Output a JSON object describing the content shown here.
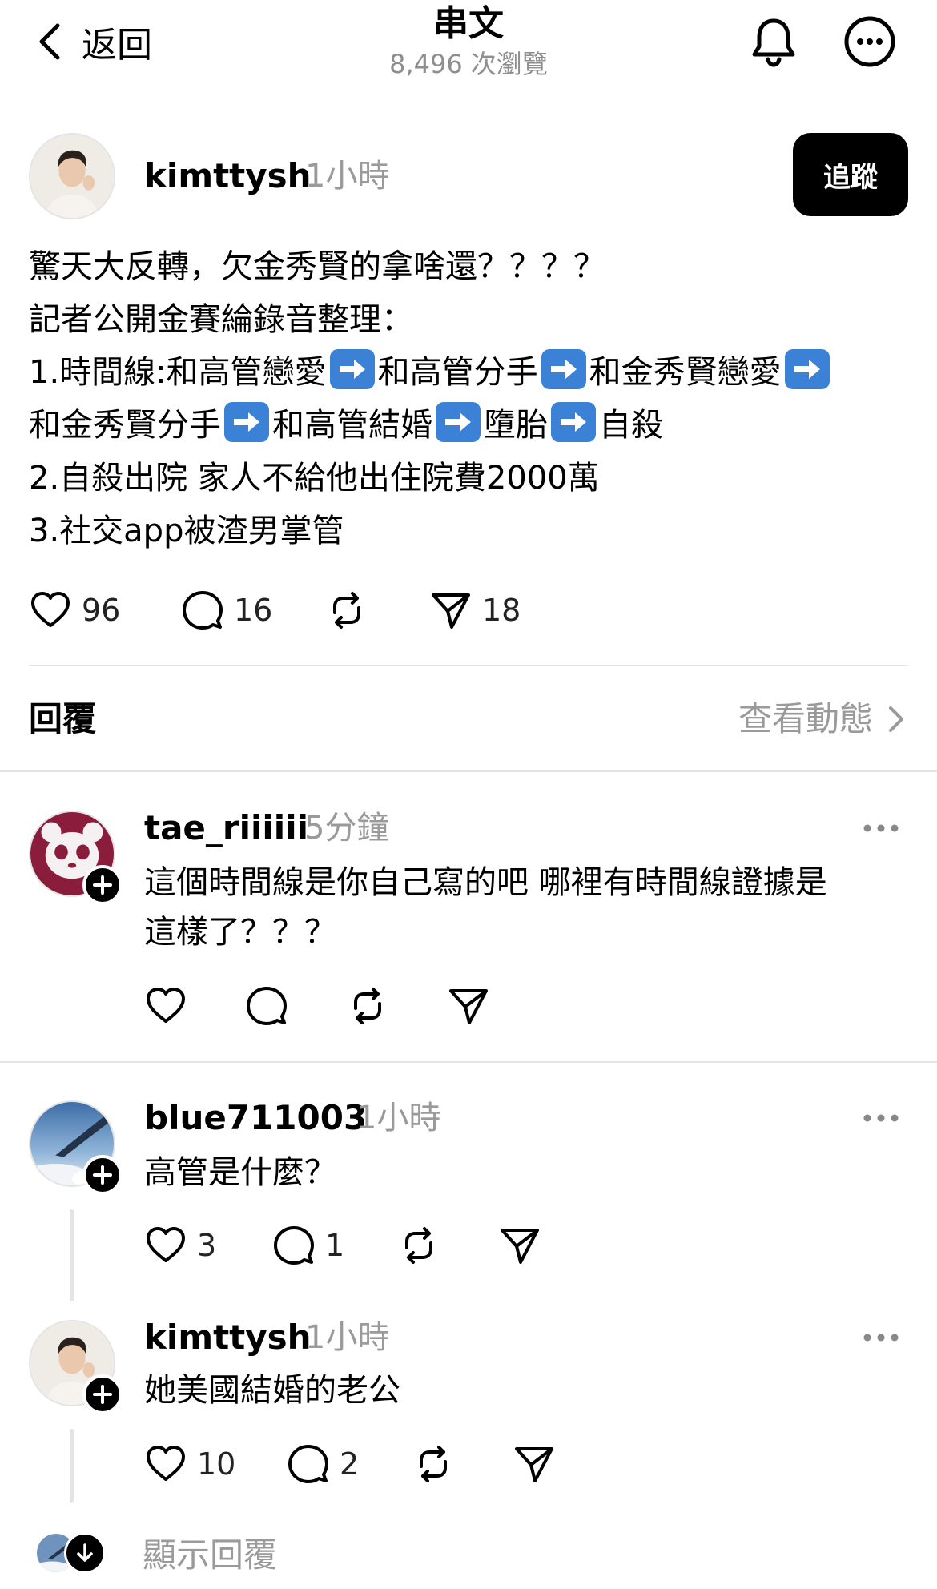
{
  "header": {
    "back_label": "返回",
    "title": "串文",
    "views": "8,496 次瀏覽"
  },
  "post": {
    "username": "kimttysh",
    "time": "1小時",
    "follow_label": "追蹤",
    "lines": {
      "l1": "驚天大反轉，欠金秀賢的拿啥還？？？？",
      "l2": "記者公開金賽綸錄音整理：",
      "l3a": "1.時間線:和高管戀愛",
      "l3b": "和高管分手",
      "l3c": "和金秀賢戀愛",
      "l4a": "和金秀賢分手",
      "l4b": "和高管結婚",
      "l4c": "墮胎",
      "l4d": "自殺",
      "l5": "2.自殺出院 家人不給他出住院費2000萬",
      "l6": "3.社交app被渣男掌管"
    },
    "likes": "96",
    "comments": "16",
    "shares": "18"
  },
  "replies_header": {
    "label": "回覆",
    "view_activity": "查看動態"
  },
  "replies": [
    {
      "username": "tae_riiiiii",
      "time": "5分鐘",
      "text_l1": "這個時間線是你自己寫的吧 哪裡有時間線證據是",
      "text_l2": "這樣了？？？"
    },
    {
      "username": "blue711003",
      "time": "1小時",
      "text": "高管是什麼？",
      "likes": "3",
      "comments": "1"
    },
    {
      "username": "kimttysh",
      "time": "1小時",
      "text": "她美國結婚的老公",
      "likes": "10",
      "comments": "2"
    }
  ],
  "show_replies_label": "顯示回覆",
  "colors": {
    "text_primary": "#000000",
    "text_secondary": "#9a9a9a",
    "divider": "#e4e4e4",
    "follow_bg": "#000000",
    "arrow_emoji_bg": "#3b82d6"
  },
  "icons": [
    "back-chevron-icon",
    "bell-icon",
    "more-icon",
    "heart-icon",
    "comment-icon",
    "repost-icon",
    "share-icon",
    "plus-icon",
    "arrow-right-emoji-icon",
    "chevron-right-icon",
    "arrow-down-icon"
  ]
}
